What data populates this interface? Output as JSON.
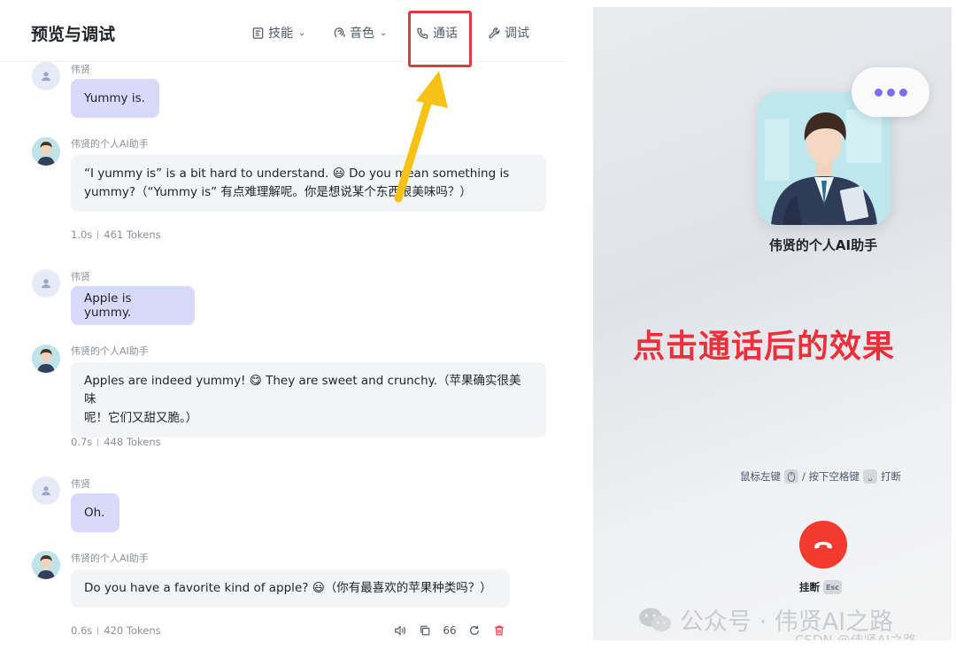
{
  "header": {
    "title": "预览与调试",
    "tabs": [
      {
        "label": "技能",
        "icon": "skill-icon",
        "has_dropdown": true
      },
      {
        "label": "音色",
        "icon": "voice-icon",
        "has_dropdown": true
      },
      {
        "label": "通话",
        "icon": "phone-icon",
        "has_dropdown": false,
        "highlighted": true
      },
      {
        "label": "调试",
        "icon": "wrench-icon",
        "has_dropdown": false
      }
    ]
  },
  "chat": {
    "user_name": "伟贤",
    "bot_name": "伟贤的个人AI助手",
    "messages": [
      {
        "role": "user",
        "text": "Yummy is."
      },
      {
        "role": "bot",
        "text_line1": "“I yummy is” is a bit hard to understand. 😃 Do you mean something is",
        "text_line2": "yummy?（“Yummy is” 有点难理解呢。你是想说某个东西很美味吗？）",
        "time": "1.0s",
        "tokens": "461 Tokens"
      },
      {
        "role": "user",
        "text": "Apple is yummy."
      },
      {
        "role": "bot",
        "text_line1": "Apples are indeed yummy! 😋 They are sweet and crunchy.（苹果确实很美味",
        "text_line2": "呢！它们又甜又脆。）",
        "time": "0.7s",
        "tokens": "448 Tokens"
      },
      {
        "role": "user",
        "text": "Oh."
      },
      {
        "role": "bot",
        "text_line1": "Do you have a favorite kind of apple? 😃（你有最喜欢的苹果种类吗？）",
        "time": "0.6s",
        "tokens": "420 Tokens"
      }
    ],
    "message_actions": [
      "speaker-icon",
      "copy-icon",
      "quote-icon",
      "regenerate-icon",
      "delete-icon"
    ],
    "quote_glyph": "66"
  },
  "call_panel": {
    "bot_name": "伟贤的个人AI助手",
    "annotation": "点击通话后的效果",
    "hint_left": "鼠标左键",
    "hint_sep": "/ 按下空格键",
    "hint_right": "打断",
    "hangup_label": "挂断",
    "hangup_key": "Esc",
    "accent_color": "#7b6df0",
    "hangup_color": "#f23a2f"
  },
  "watermark": {
    "main": "公众号 · 伟贤AI之路",
    "sub": "CSDN @伟贤AI之路"
  }
}
